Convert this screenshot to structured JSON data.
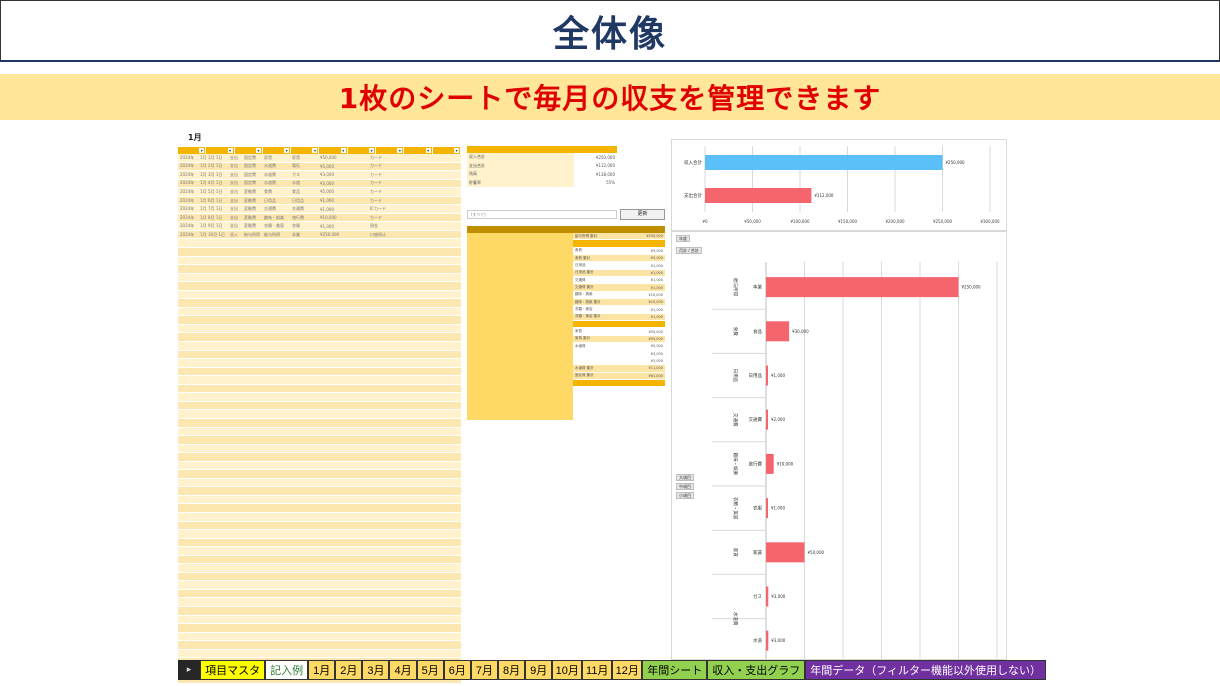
{
  "header": {
    "title": "全体像",
    "subtitle": "1枚のシートで毎月の収支を管理できます"
  },
  "ledger": {
    "month": "1月",
    "rows": [
      {
        "c": [
          "2024年",
          "1月",
          "1月 1日",
          "支出",
          "固定費",
          "家賃",
          "家賃",
          "¥50,000",
          "",
          "カード"
        ]
      },
      {
        "c": [
          "2024年",
          "1月",
          "2月 1日",
          "支出",
          "固定費",
          "水道費",
          "電気",
          "¥5,000",
          "",
          "カード"
        ]
      },
      {
        "c": [
          "2024年",
          "1月",
          "3月 1日",
          "支出",
          "固定費",
          "水道費",
          "ガス",
          "¥3,000",
          "",
          "カード"
        ]
      },
      {
        "c": [
          "2024年",
          "1月",
          "4月 1日",
          "支出",
          "固定費",
          "水道費",
          "水道",
          "¥3,000",
          "",
          "カード"
        ]
      },
      {
        "c": [
          "2024年",
          "1月",
          "5月 1日",
          "支出",
          "変動費",
          "食費",
          "食品",
          "¥5,000",
          "",
          "カード"
        ]
      },
      {
        "c": [
          "2024年",
          "1月",
          "6月 1日",
          "支出",
          "変動費",
          "日用品",
          "日用品",
          "¥1,000",
          "",
          "カード"
        ]
      },
      {
        "c": [
          "2024年",
          "1月",
          "7月 1日",
          "支出",
          "変動費",
          "交通費",
          "交通費",
          "¥1,000",
          "",
          "ICカード"
        ]
      },
      {
        "c": [
          "2024年",
          "1月",
          "8月 1日",
          "支出",
          "変動費",
          "趣味・娯楽",
          "旅行費",
          "¥10,000",
          "",
          "カード"
        ]
      },
      {
        "c": [
          "2024年",
          "1月",
          "9月 1日",
          "支出",
          "変動費",
          "衣類・美容",
          "衣服",
          "¥1,000",
          "",
          "現金"
        ]
      },
      {
        "c": [
          "2024年",
          "1月",
          "10月 1日",
          "収入",
          "給与所得",
          "給与所得",
          "本業",
          "¥250,000",
          "",
          "口座振込"
        ]
      }
    ]
  },
  "pivot": {
    "summary_rows": [
      {
        "k": "収入合計",
        "v": "¥250,000"
      },
      {
        "k": "支出合計",
        "v": "¥112,000"
      },
      {
        "k": "残高",
        "v": "¥138,000"
      },
      {
        "k": "貯蓄率",
        "v": "55%"
      }
    ],
    "filter_value": "(すべて)",
    "update_label": "更新",
    "rows": [
      {
        "t": "給与所得 集計",
        "v": "¥250,000",
        "style": "total"
      },
      {
        "t": "",
        "v": "",
        "style": "band"
      },
      {
        "t": "食費",
        "v": "¥5,000",
        "style": "plain"
      },
      {
        "t": "食費 集計",
        "v": "¥5,000",
        "style": "total"
      },
      {
        "t": "日用品",
        "v": "¥1,000",
        "style": "plain"
      },
      {
        "t": "日用品 集計",
        "v": "¥1,000",
        "style": "total"
      },
      {
        "t": "交通費",
        "v": "¥1,000",
        "style": "plain"
      },
      {
        "t": "交通費 集計",
        "v": "¥1,000",
        "style": "total"
      },
      {
        "t": "趣味・娯楽",
        "v": "¥10,000",
        "style": "plain"
      },
      {
        "t": "趣味・娯楽 集計",
        "v": "¥10,000",
        "style": "total"
      },
      {
        "t": "衣類・美容",
        "v": "¥1,000",
        "style": "plain"
      },
      {
        "t": "衣類・美容 集計",
        "v": "¥1,000",
        "style": "total"
      },
      {
        "t": "",
        "v": "",
        "style": "band"
      },
      {
        "t": "家賃",
        "v": "¥50,000",
        "style": "plain"
      },
      {
        "t": "家賃 集計",
        "v": "¥50,000",
        "style": "total"
      },
      {
        "t": "水道費",
        "v": "¥5,000",
        "style": "plain"
      },
      {
        "t": "",
        "v": "¥3,000",
        "style": "plain"
      },
      {
        "t": "",
        "v": "¥3,000",
        "style": "plain"
      },
      {
        "t": "水道費 集計",
        "v": "¥11,000",
        "style": "total"
      },
      {
        "t": "固定費 集計",
        "v": "¥61,000",
        "style": "total"
      },
      {
        "t": "",
        "v": "",
        "style": "band"
      }
    ]
  },
  "chart_data": [
    {
      "type": "bar",
      "orientation": "horizontal",
      "categories": [
        "収入合計",
        "支出合計"
      ],
      "values": [
        250000,
        112000
      ],
      "value_labels": [
        "¥250,000",
        "¥112,000"
      ],
      "colors": [
        "#5bc0f8",
        "#f4656d"
      ],
      "xlim": [
        0,
        300000
      ],
      "ticks": [
        "¥0",
        "¥50,000",
        "¥100,000",
        "¥150,000",
        "¥200,000",
        "¥250,000",
        "¥300,000"
      ],
      "grid": true
    },
    {
      "type": "bar",
      "orientation": "horizontal",
      "groups": [
        "給与所得",
        "食費",
        "日用品",
        "交通費",
        "趣味・娯楽",
        "衣類・美容",
        "家賃",
        "水道費"
      ],
      "categories": [
        "本業",
        "食品",
        "日用品",
        "交通費",
        "旅行費",
        "衣服",
        "家賃",
        "ガス",
        "水道"
      ],
      "values": [
        250000,
        30000,
        1000,
        2000,
        10000,
        1000,
        50000,
        3000,
        3000
      ],
      "value_labels": [
        "¥250,000",
        "¥30,000",
        "¥1,000",
        "¥2,000",
        "¥10,000",
        "¥1,000",
        "¥50,000",
        "¥3,000",
        "¥3,000"
      ],
      "color": "#f4656d",
      "grid": true,
      "filter_chips": [
        "年度",
        "月計 / 合計",
        "大項目",
        "中項目",
        "小項目"
      ]
    }
  ],
  "tabs": [
    {
      "label": "項目マスタ",
      "style": "yellow"
    },
    {
      "label": "記入例",
      "style": "white"
    },
    {
      "label": "1月",
      "style": "peach"
    },
    {
      "label": "2月",
      "style": "peach"
    },
    {
      "label": "3月",
      "style": "peach"
    },
    {
      "label": "4月",
      "style": "peach"
    },
    {
      "label": "5月",
      "style": "peach"
    },
    {
      "label": "6月",
      "style": "peach"
    },
    {
      "label": "7月",
      "style": "peach"
    },
    {
      "label": "8月",
      "style": "peach"
    },
    {
      "label": "9月",
      "style": "peach"
    },
    {
      "label": "10月",
      "style": "peach"
    },
    {
      "label": "11月",
      "style": "peach"
    },
    {
      "label": "12月",
      "style": "peach"
    },
    {
      "label": "年間シート",
      "style": "green"
    },
    {
      "label": "収入・支出グラフ",
      "style": "green"
    },
    {
      "label": "年間データ（フィルター機能以外使用しない）",
      "style": "purple"
    }
  ],
  "tab_nav": "▸"
}
